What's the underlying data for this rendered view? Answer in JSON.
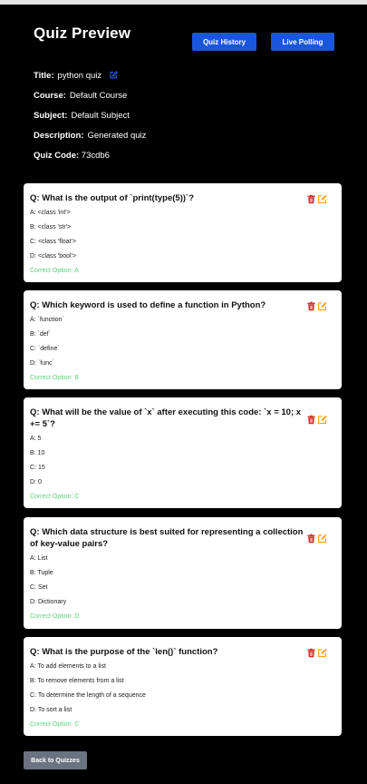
{
  "header": {
    "title": "Quiz Preview",
    "history_button": "Quiz History",
    "polling_button": "Live Polling"
  },
  "quiz": {
    "title_label": "Title:",
    "title_value": "python quiz",
    "course_label": "Course:",
    "course_value": "Default Course",
    "subject_label": "Subject:",
    "subject_value": "Default Subject",
    "description_label": "Description:",
    "description_value": "Generated quiz",
    "code_label": "Quiz Code:",
    "code_value": "73cdb6"
  },
  "questions": [
    {
      "text": "Q: What is the output of `print(type(5))`?",
      "options": [
        "A: <class 'int'>",
        "B: <class 'str'>",
        "C: <class 'float'>",
        "D: <class 'bool'>"
      ],
      "correct": "Correct Option: A"
    },
    {
      "text": "Q: Which keyword is used to define a function in Python?",
      "options": [
        "A: `function`",
        "B: `def`",
        "C: `define`",
        "D: `func`"
      ],
      "correct": "Correct Option: B"
    },
    {
      "text": "Q: What will be the value of `x` after executing this code: `x = 10; x += 5`?",
      "options": [
        "A: 5",
        "B: 10",
        "C: 15",
        "D: 0"
      ],
      "correct": "Correct Option: C"
    },
    {
      "text": "Q: Which data structure is best suited for representing a collection of key-value pairs?",
      "options": [
        "A: List",
        "B: Tuple",
        "C: Set",
        "D: Dictionary"
      ],
      "correct": "Correct Option: D"
    },
    {
      "text": "Q: What is the purpose of the `len()` function?",
      "options": [
        "A: To add elements to a list",
        "B: To remove elements from a list",
        "C: To determine the length of a sequence",
        "D: To sort a list"
      ],
      "correct": "Correct Option: C"
    }
  ],
  "footer": {
    "back_button": "Back to Quizzes"
  },
  "icons": {
    "delete": "trash-icon",
    "edit": "edit-icon"
  },
  "colors": {
    "primary": "#1a56db",
    "danger": "#dc2626",
    "warning": "#f5a623",
    "success": "#5bd27a",
    "secondary": "#6b7280"
  }
}
